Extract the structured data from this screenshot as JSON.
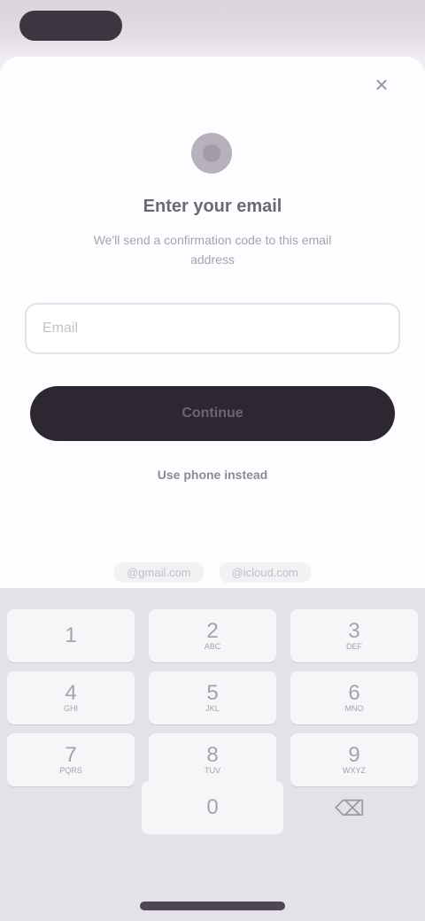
{
  "sheet": {
    "close_icon": "✕",
    "heading": "Enter your email",
    "subtitle": "We'll send a confirmation code to this email address",
    "email_placeholder": "Email",
    "continue_label": "Continue",
    "secondary_link": "Use phone instead"
  },
  "keyboard": {
    "suggestions": [
      "@gmail.com",
      "@icloud.com"
    ],
    "rows": [
      [
        {
          "main": "1",
          "sub": ""
        },
        {
          "main": "2",
          "sub": "ABC"
        },
        {
          "main": "3",
          "sub": "DEF"
        }
      ],
      [
        {
          "main": "4",
          "sub": "GHI"
        },
        {
          "main": "5",
          "sub": "JKL"
        },
        {
          "main": "6",
          "sub": "MNO"
        }
      ],
      [
        {
          "main": "7",
          "sub": "PQRS"
        },
        {
          "main": "8",
          "sub": "TUV"
        },
        {
          "main": "9",
          "sub": "WXYZ"
        }
      ]
    ],
    "zero": "0",
    "backspace_icon": "⌫"
  },
  "colors": {
    "primary_button": "#2c2730",
    "keyboard_bg": "#e4e2e8"
  }
}
